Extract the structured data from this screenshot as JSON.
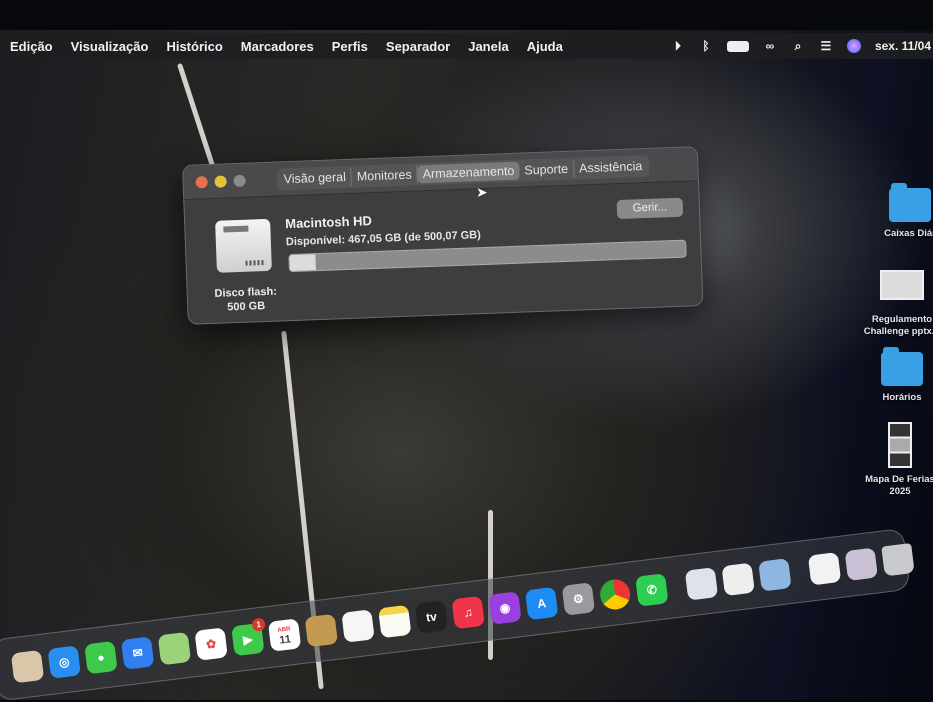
{
  "menubar": {
    "items": [
      "Edição",
      "Visualização",
      "Histórico",
      "Marcadores",
      "Perfis",
      "Separador",
      "Janela",
      "Ajuda"
    ],
    "clock": "sex. 11/04"
  },
  "window": {
    "tabs": [
      "Visão geral",
      "Monitores",
      "Armazenamento",
      "Suporte",
      "Assistência"
    ],
    "active_tab": "Armazenamento",
    "volume_name": "Macintosh HD",
    "available": "Disponível: 467,05 GB (de 500,07 GB)",
    "manage_button": "Gerir...",
    "disk_type": "Disco flash:",
    "disk_size": "500 GB",
    "used_fraction": 0.066
  },
  "desktop_icons": [
    {
      "label": "Caixas Diár",
      "kind": "folder"
    },
    {
      "label": "Regulamento Challenge pptx.p",
      "kind": "document"
    },
    {
      "label": "Horários",
      "kind": "folder"
    },
    {
      "label": "Mapa De Ferias 2025",
      "kind": "document"
    }
  ],
  "dock": {
    "calendar_month": "ABR",
    "calendar_day": "11",
    "facetime_badge": "1",
    "tv_label": "tv"
  },
  "colors": {
    "folder": "#3aa0e6",
    "close": "#e8704f",
    "minimize": "#e6c23a"
  }
}
